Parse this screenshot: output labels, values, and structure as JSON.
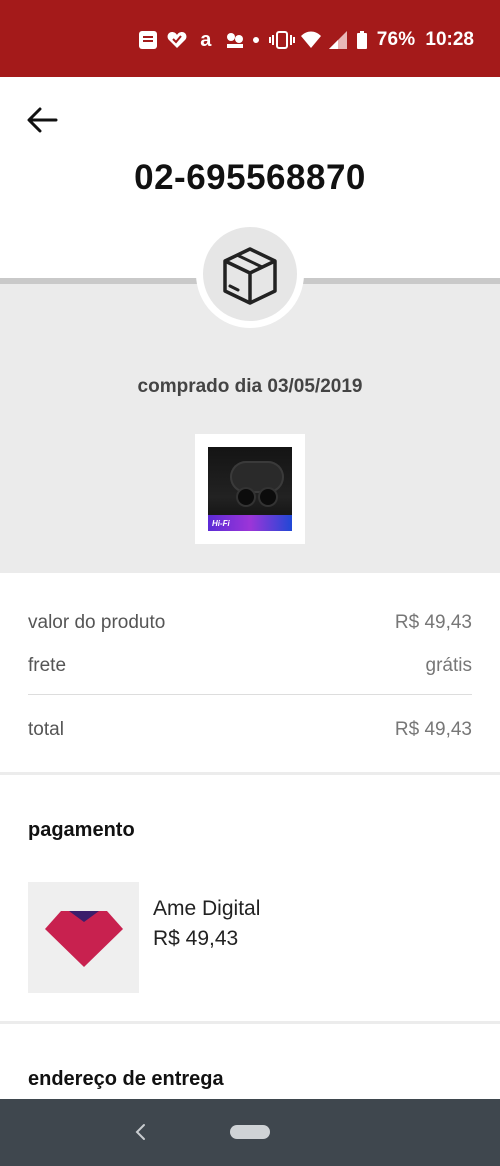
{
  "status_bar": {
    "battery_text": "76%",
    "time": "10:28",
    "background_color": "#a41a1a",
    "icons": [
      "notification-icon",
      "heart-icon",
      "amazon-icon",
      "flowers-icon",
      "dot-icon",
      "vibrate-icon",
      "wifi-icon",
      "signal-icon",
      "battery-icon"
    ]
  },
  "header": {
    "back_icon": "arrow-left-icon",
    "order_number": "02-695568870"
  },
  "tracking": {
    "status_icon": "package-box-icon",
    "purchase_date": "comprado dia 03/05/2019",
    "product_image_text": "Hi-Fi"
  },
  "summary": {
    "rows": [
      {
        "label": "valor do produto",
        "value": "R$ 49,43"
      },
      {
        "label": "frete",
        "value": "grátis"
      }
    ],
    "total_label": "total",
    "total_value": "R$ 49,43"
  },
  "payment": {
    "title": "pagamento",
    "method_name": "Ame Digital",
    "amount": "R$ 49,43",
    "logo_colors": {
      "primary": "#c8214f",
      "secondary": "#3b1e6b"
    }
  },
  "delivery": {
    "title": "endereço de entrega"
  },
  "nav_bar": {
    "back_icon": "chevron-left-icon",
    "home_icon": "home-pill-icon"
  }
}
